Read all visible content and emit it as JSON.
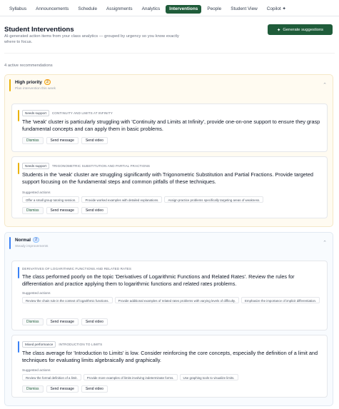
{
  "tabs": [
    "Syllabus",
    "Announcements",
    "Schedule",
    "Assignments",
    "Analytics",
    "Interventions",
    "People",
    "Student View",
    "Copilot ✦"
  ],
  "active_tab": "Interventions",
  "header": {
    "title": "Student Interventions",
    "subtitle": "AI-generated action items from your class analytics — grouped by urgency so you know exactly where to focus.",
    "generate_label": "Generate suggestions"
  },
  "count_text": "4 active recommendations",
  "labels": {
    "suggested": "Suggested actions",
    "dismiss": "Dismiss",
    "send_message": "Send message",
    "send_video": "Send video"
  },
  "groups": {
    "high": {
      "title": "High priority",
      "count": "2",
      "subtitle": "Plan intervention this week"
    },
    "normal": {
      "title": "Normal",
      "count": "2",
      "subtitle": "Steady improvements"
    }
  },
  "cards": [
    {
      "tag": "Needs support",
      "topic": "Continuity and Limits at Infinity",
      "text": "The 'weak' cluster is particularly struggling with 'Continuity and Limits at Infinity', provide one-on-one support to ensure they grasp fundamental concepts and can apply them in basic problems.",
      "suggestions": []
    },
    {
      "tag": "Needs support",
      "topic": "Trigonometric Substitution and Partial Fractions",
      "text": "Students in the 'weak' cluster are struggling significantly with Trigonometric Substitution and Partial Fractions. Provide targeted support focusing on the fundamental steps and common pitfalls of these techniques.",
      "suggestions": [
        "Offer a small group tutoring session.",
        "Provide worked examples with detailed explanations.",
        "Assign practice problems specifically targeting areas of weakness."
      ]
    },
    {
      "tag": "",
      "topic": "Derivatives of Logarithmic Functions and Related Rates",
      "text": "The class performed poorly on the topic 'Derivatives of Logarithmic Functions and Related Rates'. Review the rules for differentiation and practice applying them to logarithmic functions and related rates problems.",
      "suggestions": [
        "Review the chain rule in the context of logarithmic functions.",
        "Provide additional examples of related rates problems with varying levels of difficulty.",
        "Emphasize the importance of implicit differentiation."
      ]
    },
    {
      "tag": "Mixed performance",
      "topic": "Introduction to Limits",
      "text": "The class average for 'Introduction to Limits' is low. Consider reinforcing the core concepts, especially the definition of a limit and techniques for evaluating limits algebraically and graphically.",
      "suggestions": [
        "Review the formal definition of a limit.",
        "Provide more examples of limits involving indeterminate forms.",
        "Use graphing tools to visualize limits."
      ]
    }
  ],
  "colors": {
    "brand": "#1f5c3a",
    "high": "#eab308",
    "normal": "#3b82f6"
  }
}
